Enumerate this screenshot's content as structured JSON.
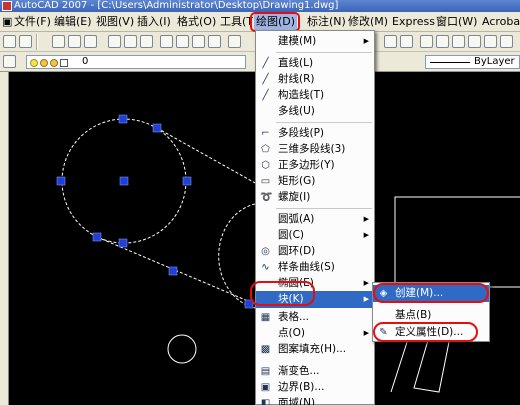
{
  "window": {
    "title": "AutoCAD 2007 - [C:\\Users\\Administrator\\Desktop\\Drawing1.dwg]"
  },
  "menubar": {
    "items": [
      {
        "label": "文件(F)"
      },
      {
        "label": "编辑(E)"
      },
      {
        "label": "视图(V)"
      },
      {
        "label": "插入(I)"
      },
      {
        "label": "格式(O)"
      },
      {
        "label": "工具(T)"
      },
      {
        "label": "绘图(D)"
      },
      {
        "label": "标注(N)"
      },
      {
        "label": "修改(M)"
      },
      {
        "label": "Express"
      },
      {
        "label": "窗口(W)"
      },
      {
        "label": "Acrobat"
      }
    ]
  },
  "layer": {
    "value": "0"
  },
  "linetype": {
    "value": "ByLayer"
  },
  "draw_menu": {
    "items": [
      {
        "label": "建模(M)",
        "icon": "",
        "submenu": true
      },
      {
        "label": "直线(L)",
        "icon": "line-icon"
      },
      {
        "label": "射线(R)",
        "icon": "ray-icon"
      },
      {
        "label": "构造线(T)",
        "icon": "xline-icon"
      },
      {
        "label": "多线(U)",
        "icon": ""
      },
      {
        "label": "多段线(P)",
        "icon": "polyline-icon"
      },
      {
        "label": "三维多段线(3)",
        "icon": "3dpoly-icon"
      },
      {
        "label": "正多边形(Y)",
        "icon": "polygon-icon"
      },
      {
        "label": "矩形(G)",
        "icon": "rectangle-icon"
      },
      {
        "label": "螺旋(I)",
        "icon": "helix-icon"
      },
      {
        "label": "圆弧(A)",
        "icon": "",
        "submenu": true
      },
      {
        "label": "圆(C)",
        "icon": "",
        "submenu": true
      },
      {
        "label": "圆环(D)",
        "icon": "donut-icon"
      },
      {
        "label": "样条曲线(S)",
        "icon": "spline-icon"
      },
      {
        "label": "椭圆(E)",
        "icon": "",
        "submenu": true
      },
      {
        "label": "块(K)",
        "icon": "",
        "submenu": true,
        "highlighted": true
      },
      {
        "label": "表格...",
        "icon": "table-icon"
      },
      {
        "label": "点(O)",
        "icon": "",
        "submenu": true
      },
      {
        "label": "图案填充(H)...",
        "icon": "hatch-icon"
      },
      {
        "label": "渐变色...",
        "icon": "gradient-icon"
      },
      {
        "label": "边界(B)...",
        "icon": "boundary-icon"
      },
      {
        "label": "面域(N)",
        "icon": "region-icon"
      }
    ]
  },
  "block_submenu": {
    "items": [
      {
        "label": "创建(M)...",
        "icon": "create-block-icon",
        "highlighted": true
      },
      {
        "label": "基点(B)",
        "icon": ""
      },
      {
        "label": "定义属性(D)...",
        "icon": "define-attribute-icon"
      }
    ]
  },
  "colors": {
    "highlight": "#316ac5",
    "annotation_red": "#e01010",
    "grip_blue": "#1f3fd6"
  }
}
